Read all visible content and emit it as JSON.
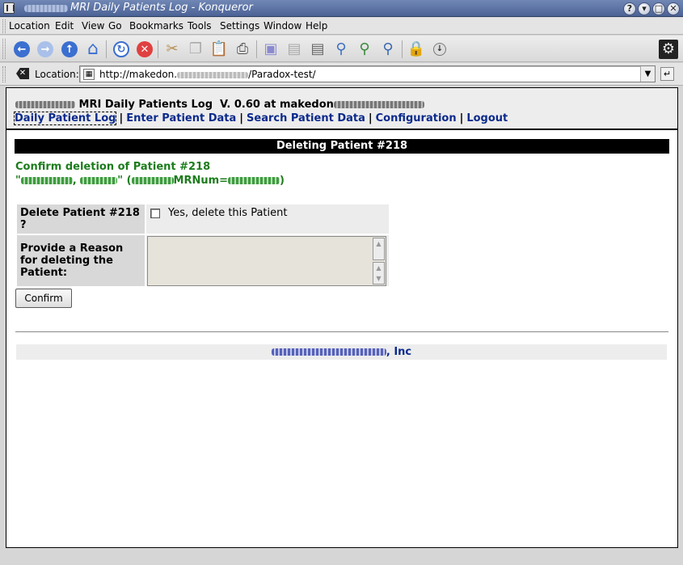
{
  "window": {
    "title": "MRI Daily Patients Log - Konqueror",
    "buttons": [
      "?",
      "▾",
      "□",
      "✕"
    ]
  },
  "menu": [
    "Location",
    "Edit",
    "View",
    "Go",
    "Bookmarks",
    "Tools",
    "Settings",
    "Window",
    "Help"
  ],
  "location": {
    "label": "Location:",
    "url_prefix": "http://makedon.",
    "url_suffix": "/Paradox-test/"
  },
  "site": {
    "title": "MRI Daily Patients Log",
    "version": "V. 0.60 at makedon",
    "nav": [
      "Daily Patient Log",
      "Enter Patient Data",
      "Search Patient Data",
      "Configuration",
      "Logout"
    ]
  },
  "page": {
    "section_title": "Deleting Patient #218",
    "confirm_heading": "Confirm deletion of Patient #218",
    "patient_quote_open": "\"",
    "patient_comma": ", ",
    "patient_quote_close": "\"",
    "mrnum_open": "(",
    "mrnum_label": "MRNum=",
    "mrnum_close": ")",
    "delete_label": "Delete Patient #218 ?",
    "delete_checkbox_label": "Yes, delete this Patient",
    "reason_label": "Provide a Reason for deleting the Patient:",
    "confirm_button": "Confirm"
  },
  "footer": {
    "company_suffix": ", Inc"
  },
  "colors": {
    "link": "#0b2a8c",
    "confirm_text": "#1c7c1c",
    "section_bar": "#000000",
    "titlebar": "#5a71a3"
  }
}
